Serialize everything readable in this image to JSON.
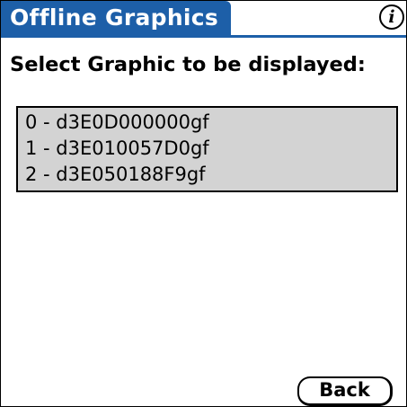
{
  "header": {
    "title": "Offline Graphics",
    "info_icon": "info-icon",
    "info_glyph": "i",
    "accent_color": "#1d5fa8"
  },
  "prompt": "Select Graphic to be displayed:",
  "graphics_list": {
    "items": [
      "0 - d3E0D000000gf",
      "1 - d3E010057D0gf",
      "2 - d3E050188F9gf"
    ],
    "background_color": "#d3d3d3"
  },
  "back_button_label": "Back"
}
